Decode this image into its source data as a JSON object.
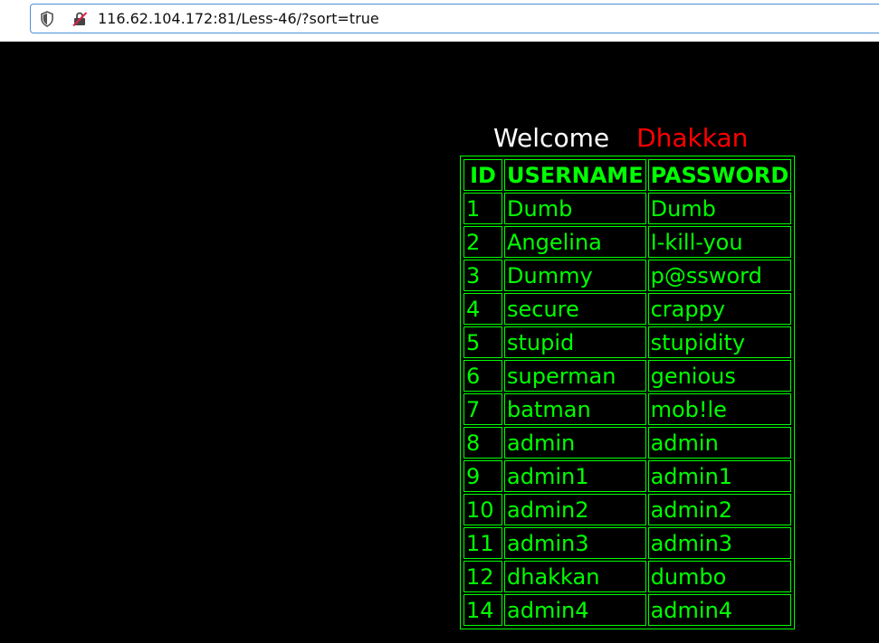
{
  "browser": {
    "url": "116.62.104.172:81/Less-46/?sort=true"
  },
  "page": {
    "welcome": "Welcome",
    "name": "Dhakkan"
  },
  "table": {
    "headers": [
      "ID",
      "USERNAME",
      "PASSWORD"
    ],
    "rows": [
      [
        "1",
        "Dumb",
        "Dumb"
      ],
      [
        "2",
        "Angelina",
        "I-kill-you"
      ],
      [
        "3",
        "Dummy",
        "p@ssword"
      ],
      [
        "4",
        "secure",
        "crappy"
      ],
      [
        "5",
        "stupid",
        "stupidity"
      ],
      [
        "6",
        "superman",
        "genious"
      ],
      [
        "7",
        "batman",
        "mob!le"
      ],
      [
        "8",
        "admin",
        "admin"
      ],
      [
        "9",
        "admin1",
        "admin1"
      ],
      [
        "10",
        "admin2",
        "admin2"
      ],
      [
        "11",
        "admin3",
        "admin3"
      ],
      [
        "12",
        "dhakkan",
        "dumbo"
      ],
      [
        "14",
        "admin4",
        "admin4"
      ]
    ]
  },
  "colors": {
    "background": "#000000",
    "table_text": "#00ff00",
    "welcome": "#ffffff",
    "name": "#ff0000"
  }
}
